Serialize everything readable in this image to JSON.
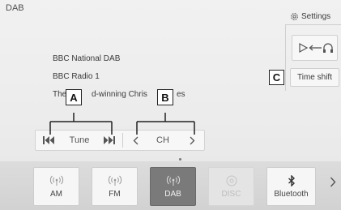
{
  "header": {
    "title": "DAB",
    "settings_label": "Settings"
  },
  "station": {
    "line1": "BBC National DAB",
    "line2": "BBC Radio 1",
    "line3": "The",
    "line3_mid": "d-winning Chris",
    "line3_end": "es"
  },
  "controls": {
    "tune_label": "Tune",
    "ch_label": "CH",
    "prev_icon": "skip-back-icon",
    "next_icon": "skip-forward-icon"
  },
  "side": {
    "source_icon": "play-to-headphones-icon",
    "timeshift_label": "Time shift"
  },
  "callouts": {
    "a": "A",
    "b": "B",
    "c": "C"
  },
  "sources": [
    {
      "label": "AM",
      "icon": "radio-waves-icon",
      "state": "normal"
    },
    {
      "label": "FM",
      "icon": "radio-waves-icon",
      "state": "normal"
    },
    {
      "label": "DAB",
      "icon": "radio-waves-icon",
      "state": "active"
    },
    {
      "label": "DISC",
      "icon": "disc-icon",
      "state": "disabled"
    },
    {
      "label": "Bluetooth",
      "icon": "bluetooth-icon",
      "state": "normal"
    }
  ],
  "colors": {
    "active_tile": "#7a7a7a",
    "callout_border": "#222222"
  }
}
